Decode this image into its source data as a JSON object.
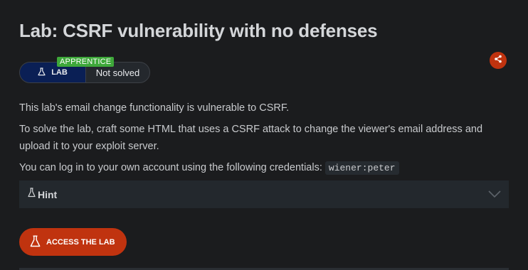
{
  "lab": {
    "title": "Lab: CSRF vulnerability with no defenses",
    "level_badge": "APPRENTICE",
    "lab_label": "LAB",
    "status": "Not solved"
  },
  "description": {
    "p1": "This lab's email change functionality is vulnerable to CSRF.",
    "p2": "To solve the lab, craft some HTML that uses a CSRF attack to change the viewer's email address and upload it to your exploit server.",
    "p3_text": "You can log in to your own account using the following credentials: ",
    "p3_code": "wiener:peter"
  },
  "hint": {
    "label": "Hint"
  },
  "access_button": {
    "label": "ACCESS THE LAB"
  },
  "icons": {
    "lab": "flask-icon",
    "share": "share-icon",
    "hint": "flask-icon",
    "expand": "chevron-down-icon",
    "access": "flask-icon"
  },
  "colors": {
    "background": "#1b1c1e",
    "accent": "#c0330f",
    "level_badge": "#3ea83a",
    "lab_pill": "#0a1f55",
    "hint_bg": "#23282d"
  }
}
